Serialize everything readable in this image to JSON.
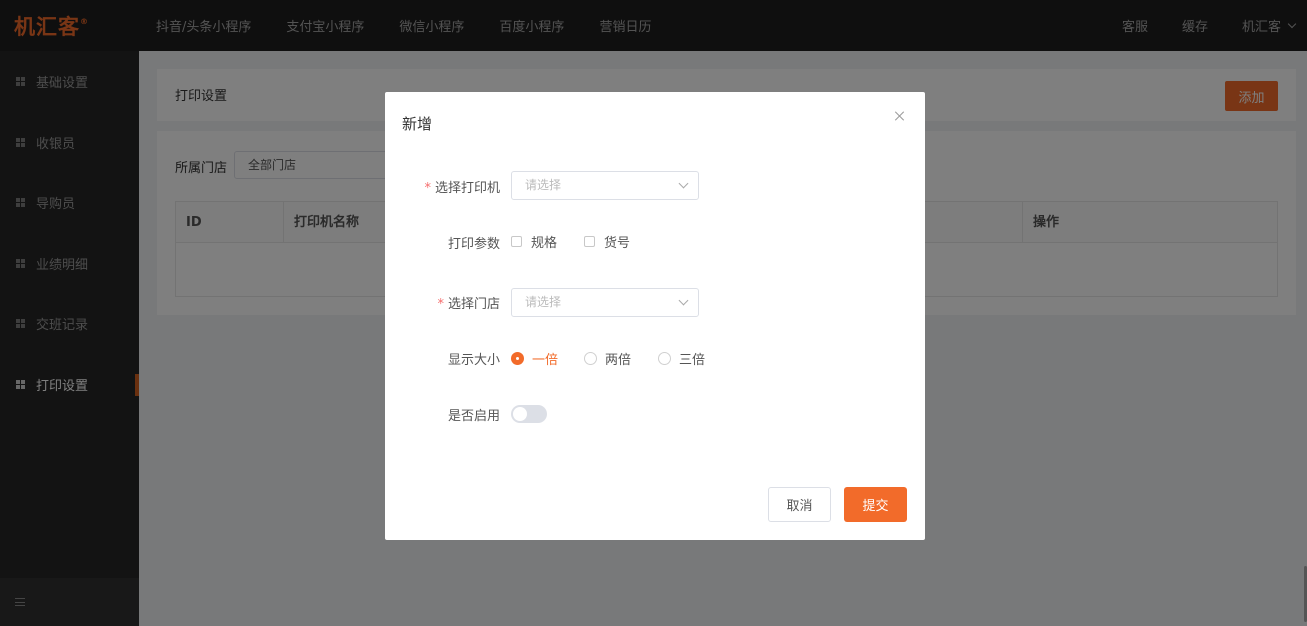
{
  "brand": {
    "name": "机汇客",
    "mark": "®"
  },
  "topnav": {
    "items": [
      "抖音/头条小程序",
      "支付宝小程序",
      "微信小程序",
      "百度小程序",
      "营销日历"
    ],
    "service": "客服",
    "cache": "缓存",
    "user": "机汇客"
  },
  "sidebar": {
    "items": [
      {
        "label": "基础设置"
      },
      {
        "label": "收银员"
      },
      {
        "label": "导购员"
      },
      {
        "label": "业绩明细"
      },
      {
        "label": "交班记录"
      },
      {
        "label": "打印设置",
        "active": true
      }
    ]
  },
  "page": {
    "title": "打印设置",
    "add_button": "添加",
    "filter": {
      "label": "所属门店",
      "value": "全部门店"
    },
    "table": {
      "headers": [
        "ID",
        "打印机名称",
        "操作"
      ]
    }
  },
  "modal": {
    "title": "新增",
    "printer": {
      "label": "选择打印机",
      "placeholder": "请选择",
      "required": true
    },
    "params": {
      "label": "打印参数",
      "options": [
        "规格",
        "货号"
      ]
    },
    "store": {
      "label": "选择门店",
      "placeholder": "请选择",
      "required": true
    },
    "size": {
      "label": "显示大小",
      "options": [
        "一倍",
        "两倍",
        "三倍"
      ],
      "selected": "一倍"
    },
    "enabled": {
      "label": "是否启用",
      "value": false
    },
    "cancel": "取消",
    "submit": "提交"
  },
  "colors": {
    "accent": "#f26b2a",
    "topbar": "#1f1f1f",
    "sidebar": "#262626"
  }
}
